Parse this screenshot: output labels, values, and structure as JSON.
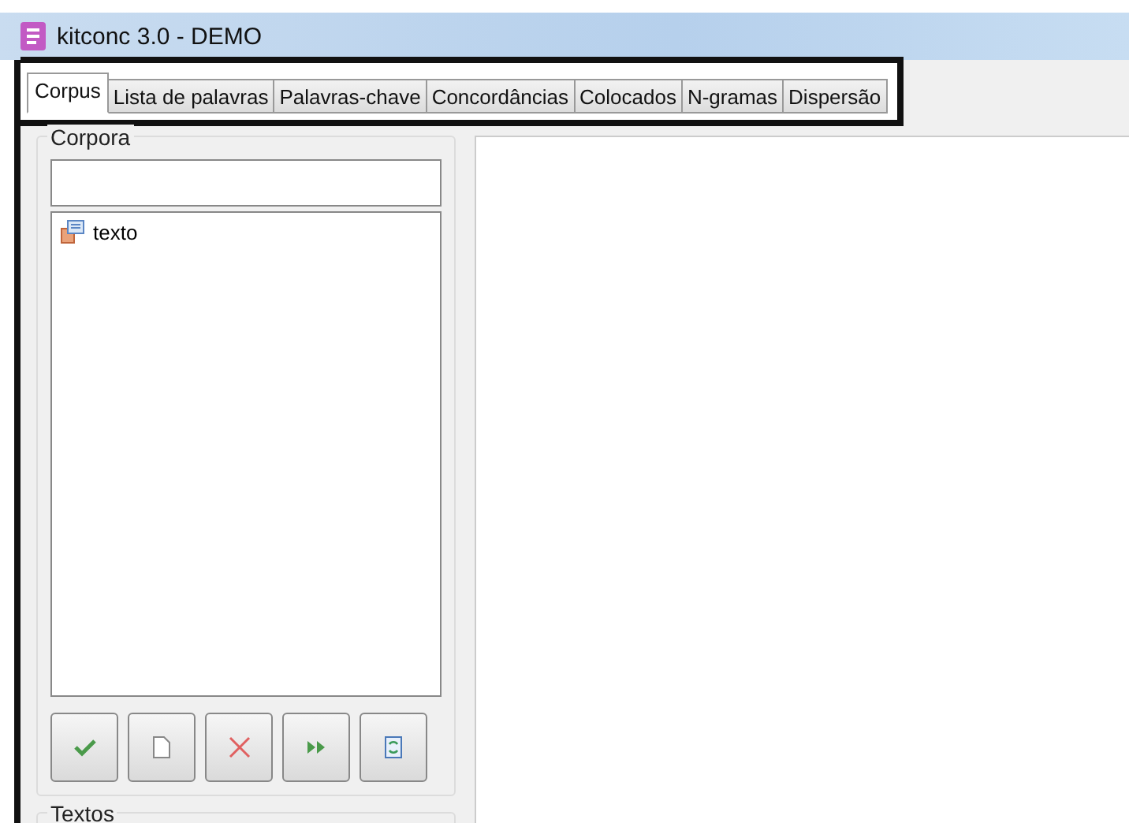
{
  "window": {
    "title": "kitconc 3.0 - DEMO"
  },
  "tabs": [
    {
      "label": "Corpus",
      "selected": true
    },
    {
      "label": "Lista de palavras",
      "selected": false
    },
    {
      "label": "Palavras-chave",
      "selected": false
    },
    {
      "label": "Concordâncias",
      "selected": false
    },
    {
      "label": "Colocados",
      "selected": false
    },
    {
      "label": "N-gramas",
      "selected": false
    },
    {
      "label": "Dispersão",
      "selected": false
    }
  ],
  "corpora": {
    "title": "Corpora",
    "items": [
      {
        "label": "texto"
      }
    ],
    "buttons": [
      {
        "kind": "check"
      },
      {
        "kind": "new"
      },
      {
        "kind": "delete"
      },
      {
        "kind": "forward"
      },
      {
        "kind": "refresh"
      }
    ]
  },
  "texts": {
    "title": "Textos"
  }
}
